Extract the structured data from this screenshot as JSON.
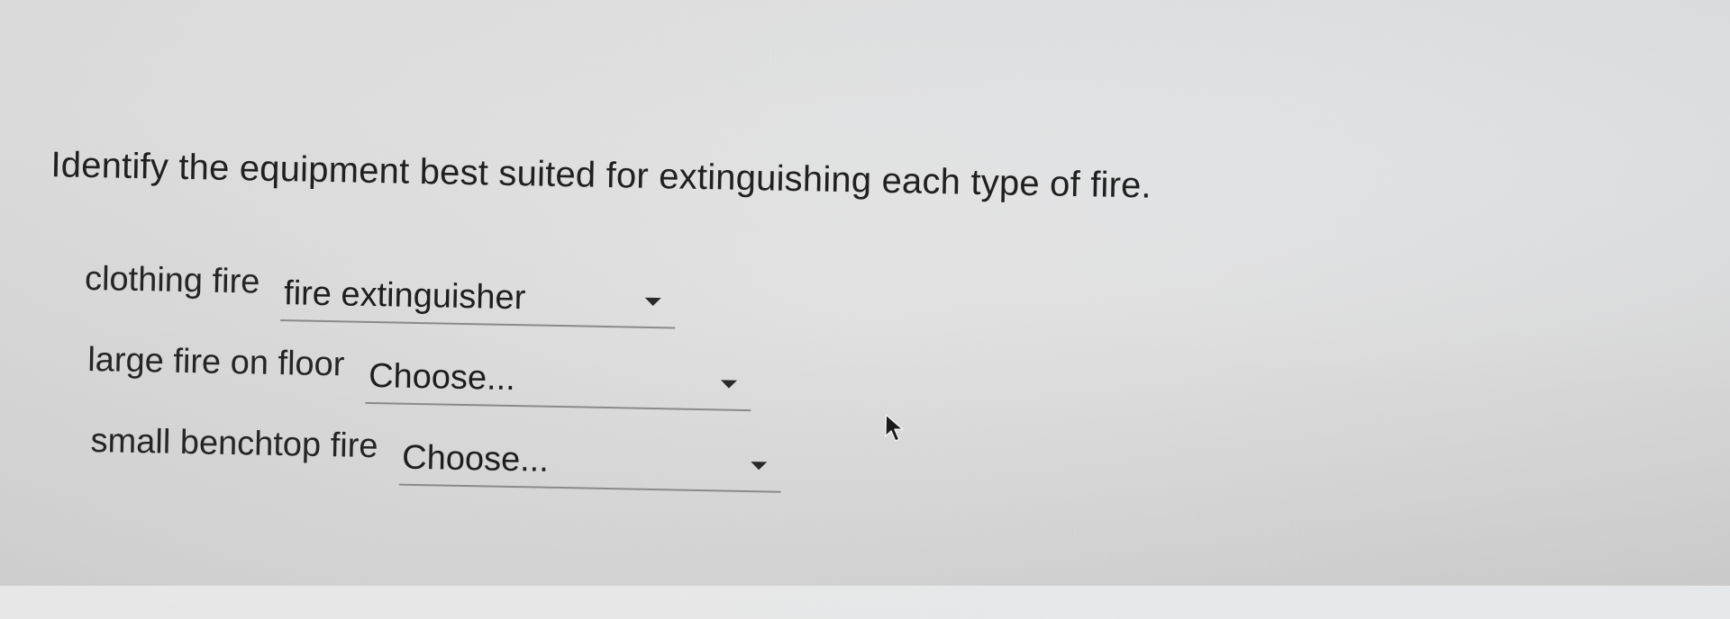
{
  "question": {
    "text": "Identify the equipment best suited for extinguishing each type of fire."
  },
  "rows": [
    {
      "label": "clothing fire",
      "selected": "fire extinguisher"
    },
    {
      "label": "large fire on floor",
      "selected": "Choose..."
    },
    {
      "label": "small benchtop fire",
      "selected": "Choose..."
    }
  ],
  "icons": {
    "dropdown": "chevron-down-icon",
    "pointer": "mouse-cursor-icon"
  },
  "colors": {
    "text": "#202020",
    "underline": "#8a8a8a",
    "background": "#e2e2e2"
  }
}
